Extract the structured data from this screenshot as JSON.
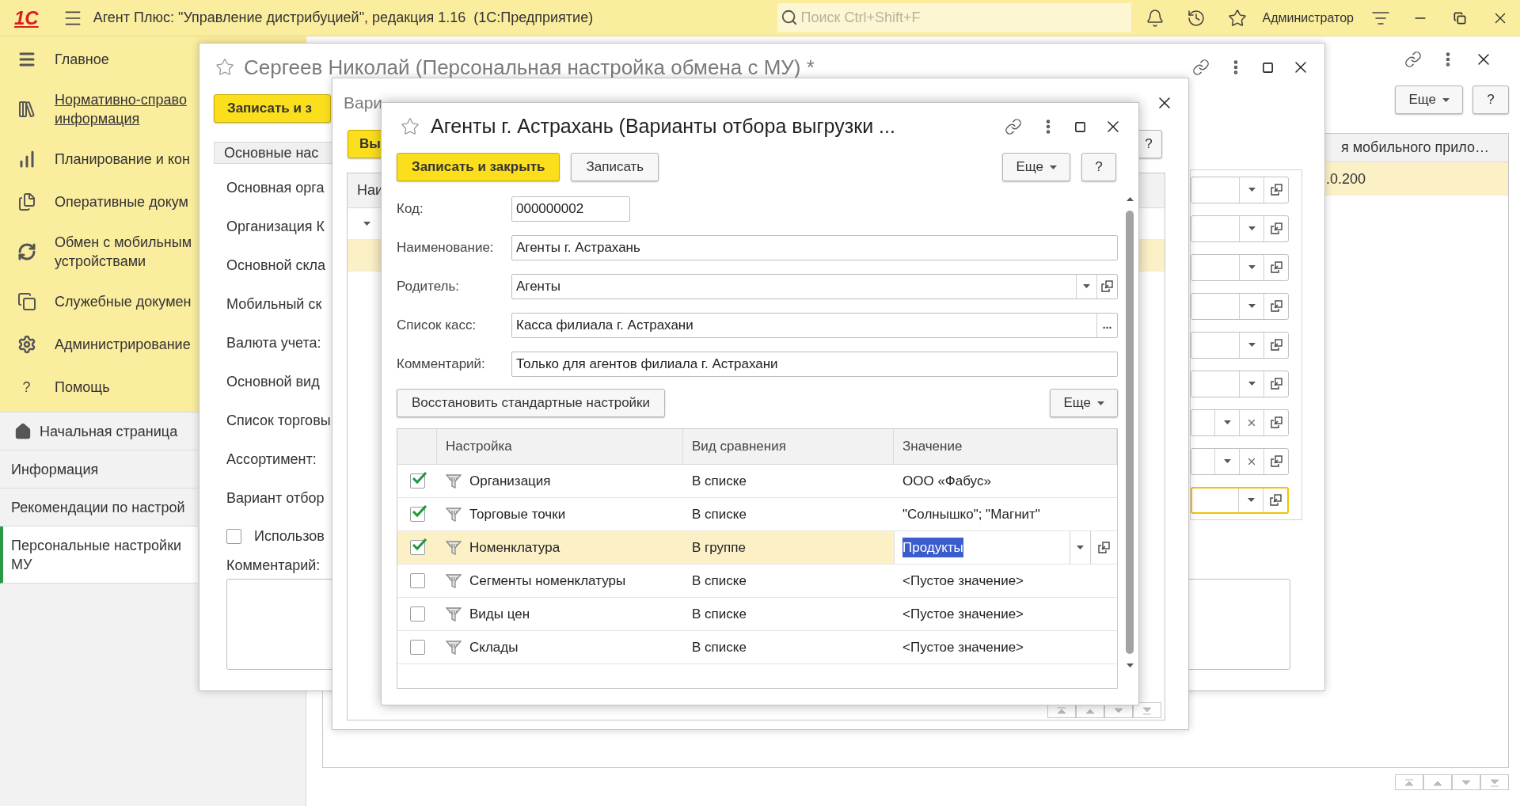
{
  "app_bar": {
    "logo": "1С",
    "title": "Агент Плюс: \"Управление дистрибуцией\", редакция 1.16  (1С:Предприятие)",
    "search": {
      "placeholder": "Поиск Ctrl+Shift+F"
    },
    "user": "Администратор"
  },
  "sidebar": {
    "sections": [
      {
        "kind": "main",
        "lines": [
          "Главное"
        ],
        "link": false
      },
      {
        "kind": "catalog",
        "lines": [
          "Нормативно-справо",
          "информация"
        ],
        "link": true
      },
      {
        "kind": "planning",
        "lines": [
          "Планирование и кон"
        ],
        "link": false
      },
      {
        "kind": "documents",
        "lines": [
          "Оперативные докум"
        ],
        "link": false
      },
      {
        "kind": "sync",
        "lines": [
          "Обмен с мобильным",
          "устройствами"
        ],
        "link": false
      },
      {
        "kind": "service",
        "lines": [
          "Служебные докумен"
        ],
        "link": false
      },
      {
        "kind": "admin",
        "lines": [
          "Администрирование"
        ],
        "link": false
      },
      {
        "kind": "help",
        "glyph": "?",
        "lines": [
          "Помощь"
        ],
        "link": false
      }
    ],
    "nav": [
      {
        "kind": "home",
        "lines": [
          "Начальная страница"
        ],
        "selected": false
      },
      {
        "kind": "page",
        "lines": [
          "Информация"
        ],
        "selected": false
      },
      {
        "kind": "page",
        "lines": [
          "Рекомендации по настрой"
        ],
        "selected": false
      },
      {
        "kind": "page",
        "lines": [
          "Персональные настройки",
          "МУ"
        ],
        "selected": true
      }
    ]
  },
  "page": {
    "buttons": [
      "Еще",
      "?"
    ],
    "table": {
      "column_header": "я мобильного прило…",
      "rows": [
        {
          "cell": ".0.200",
          "selected": true
        }
      ]
    }
  },
  "window_1": {
    "title": "Сергеев Николай (Персональная настройка обмена с МУ) *",
    "save_button": "Записать и з",
    "group": "Основные нас",
    "labels": [
      "Основная орга",
      "Организация К",
      "Основной скла",
      "Мобильный ск",
      "Валюта учета:",
      "Основной вид",
      "Список торговы",
      "Ассортимент:",
      "Вариант отбор"
    ],
    "fields": [
      {
        "clear": false,
        "focused": false
      },
      {
        "clear": false,
        "focused": false
      },
      {
        "clear": false,
        "focused": false
      },
      {
        "clear": false,
        "focused": false
      },
      {
        "clear": false,
        "focused": false
      },
      {
        "clear": false,
        "focused": false
      },
      {
        "clear": true,
        "focused": false
      },
      {
        "clear": true,
        "focused": false
      },
      {
        "clear": false,
        "focused": true
      }
    ],
    "checkbox": {
      "label": "Использов",
      "checked": false
    },
    "comment_label": "Комментарий:"
  },
  "window_2": {
    "title": "Вари",
    "buttons": [
      "Вы",
      "?"
    ],
    "table": {
      "column_header": "Наи",
      "rows": [
        {
          "expanded": true,
          "selected": false
        },
        {
          "expanded": false,
          "selected": true
        }
      ]
    }
  },
  "window_3": {
    "title": "Агенты г. Астрахань (Варианты отбора выгрузки ...",
    "buttons": [
      {
        "label": "Записать и закрыть",
        "kind": "primary"
      },
      {
        "label": "Записать",
        "kind": "default"
      }
    ],
    "more": "Еще",
    "help": "?",
    "fields": [
      {
        "label": "Код:",
        "value": "000000002",
        "kind": "short"
      },
      {
        "label": "Наименование:",
        "value": "Агенты г. Астрахань",
        "kind": "text"
      },
      {
        "label": "Родитель:",
        "value": "Агенты",
        "kind": "select"
      },
      {
        "label": "Список касс:",
        "value": "Касса филиала г. Астрахани",
        "kind": "choice",
        "button": "..."
      },
      {
        "label": "Комментарий:",
        "value": "Только для агентов филиала г. Астрахани",
        "kind": "text"
      }
    ],
    "restore_button": "Восстановить стандартные настройки",
    "table_more": "Еще",
    "table": {
      "columns": [
        "Настройка",
        "Вид сравнения",
        "Значение"
      ],
      "rows": [
        {
          "checked": true,
          "setting": "Организация",
          "comparison": "В списке",
          "value": "ООО «Фабус»",
          "selected": false
        },
        {
          "checked": true,
          "setting": "Торговые точки",
          "comparison": "В списке",
          "value": "\"Солнышко\"; \"Магнит\"",
          "selected": false
        },
        {
          "checked": true,
          "setting": "Номенклатура",
          "comparison": "В группе",
          "value": "Продукты",
          "selected": true
        },
        {
          "checked": false,
          "setting": "Сегменты номенклатуры",
          "comparison": "В списке",
          "value": "<Пустое значение>",
          "selected": false
        },
        {
          "checked": false,
          "setting": "Виды цен",
          "comparison": "В списке",
          "value": "<Пустое значение>",
          "selected": false
        },
        {
          "checked": false,
          "setting": "Склады",
          "comparison": "В списке",
          "value": "<Пустое значение>",
          "selected": false
        }
      ]
    }
  }
}
